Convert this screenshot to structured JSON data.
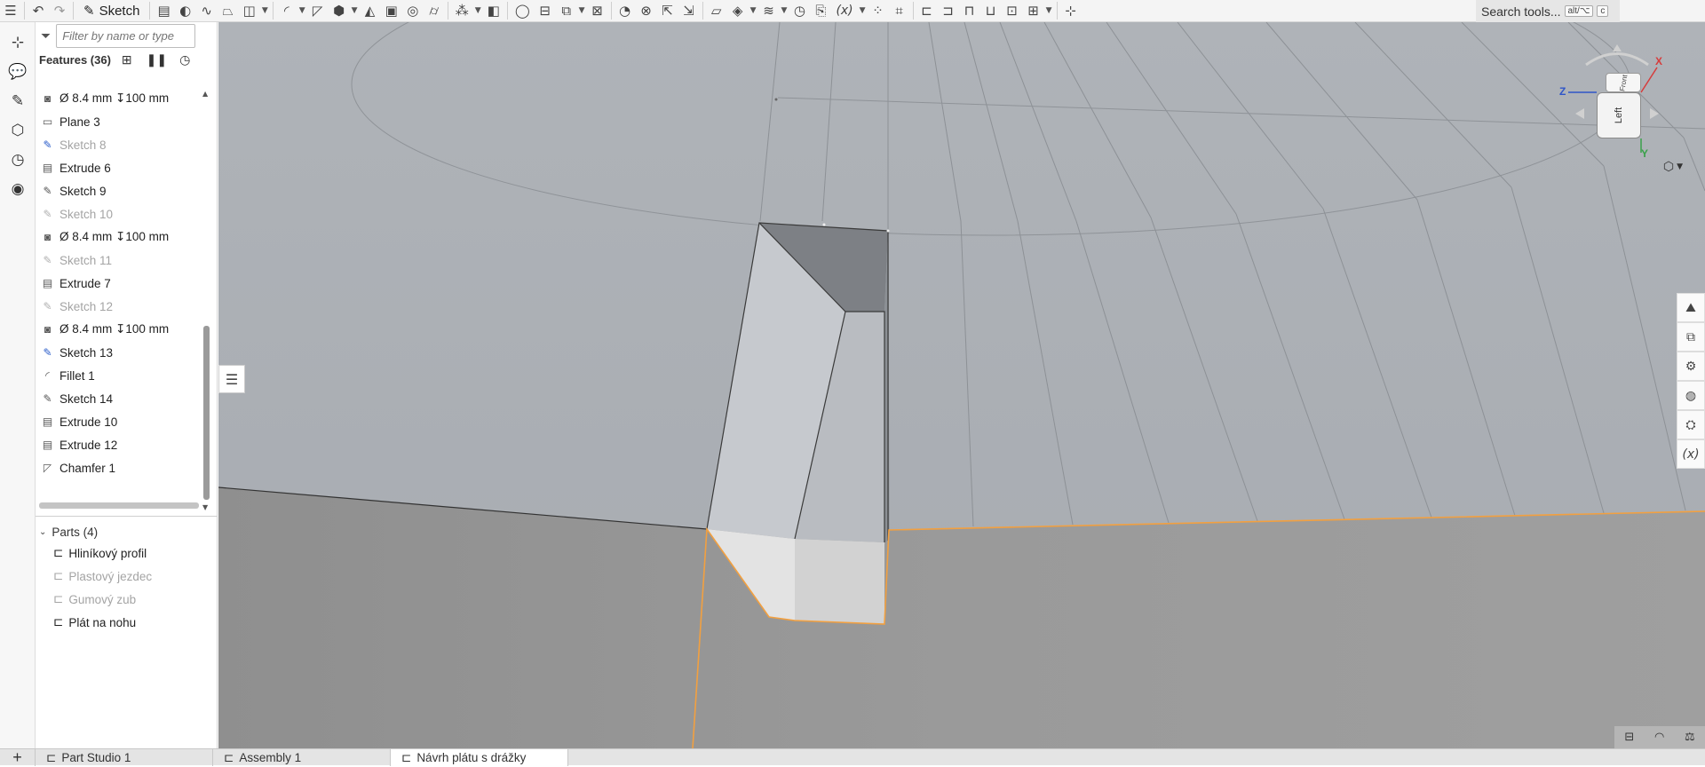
{
  "toolbar": {
    "sketch_label": "Sketch",
    "search_label": "Search tools...",
    "search_shortcut_1": "alt/⌥",
    "search_shortcut_2": "c"
  },
  "feature_panel": {
    "filter_placeholder": "Filter by name or type",
    "features_title": "Features (36)",
    "features": [
      {
        "label": "Ø 8.4 mm ↧100 mm",
        "icon": "hole-icon",
        "suppressed": false
      },
      {
        "label": "Plane 3",
        "icon": "plane-icon",
        "suppressed": false
      },
      {
        "label": "Sketch 8",
        "icon": "sketch-icon",
        "suppressed": true,
        "error": true
      },
      {
        "label": "Extrude 6",
        "icon": "extrude-icon",
        "suppressed": false
      },
      {
        "label": "Sketch 9",
        "icon": "sketch-icon",
        "suppressed": false
      },
      {
        "label": "Sketch 10",
        "icon": "sketch-icon",
        "suppressed": true
      },
      {
        "label": "Ø 8.4 mm ↧100 mm",
        "icon": "hole-icon",
        "suppressed": false
      },
      {
        "label": "Sketch 11",
        "icon": "sketch-icon",
        "suppressed": true
      },
      {
        "label": "Extrude 7",
        "icon": "extrude-icon",
        "suppressed": false
      },
      {
        "label": "Sketch 12",
        "icon": "sketch-icon",
        "suppressed": true
      },
      {
        "label": "Ø 8.4 mm ↧100 mm",
        "icon": "hole-icon",
        "suppressed": false
      },
      {
        "label": "Sketch 13",
        "icon": "sketch-icon",
        "suppressed": false,
        "error": true
      },
      {
        "label": "Fillet 1",
        "icon": "fillet-icon",
        "suppressed": false
      },
      {
        "label": "Sketch 14",
        "icon": "sketch-icon",
        "suppressed": false
      },
      {
        "label": "Extrude 10",
        "icon": "extrude-icon",
        "suppressed": false
      },
      {
        "label": "Extrude 12",
        "icon": "extrude-icon",
        "suppressed": false
      },
      {
        "label": "Chamfer 1",
        "icon": "chamfer-icon",
        "suppressed": false
      }
    ],
    "parts_title": "Parts (4)",
    "parts": [
      {
        "label": "Hliníkový profil",
        "hidden": false
      },
      {
        "label": "Plastový jezdec",
        "hidden": true
      },
      {
        "label": "Gumový zub",
        "hidden": true
      },
      {
        "label": "Plát na nohu",
        "hidden": false
      }
    ]
  },
  "view_cube": {
    "front_label": "Left",
    "top_label": "Front",
    "axis_x": "X",
    "axis_y": "Y",
    "axis_z": "Z",
    "colors": {
      "x": "#d63c3c",
      "y": "#3aa14a",
      "z": "#2f55c8"
    }
  },
  "tabs": [
    {
      "label": "Part Studio 1",
      "active": false
    },
    {
      "label": "Assembly 1",
      "active": false
    },
    {
      "label": "Návrh plátu s drážky",
      "active": true
    }
  ],
  "colors": {
    "selection_edge": "#f2a040",
    "viewport_bg": "#a9aeb4"
  }
}
